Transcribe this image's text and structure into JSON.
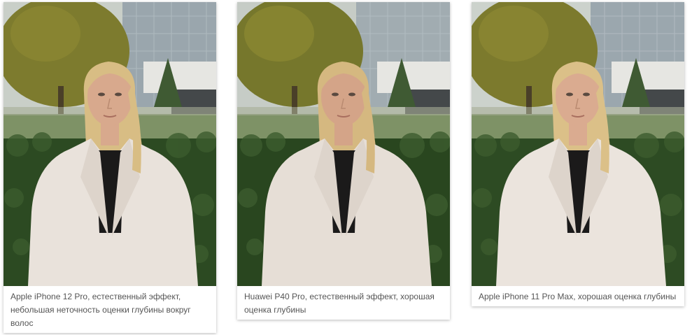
{
  "photos": [
    {
      "caption": "Apple iPhone 12 Pro, естественный эффект, небольшая неточность оценки глубины вокруг волос",
      "subject": "portrait of a blonde woman in a white fluffy coat in front of a hedge",
      "palette": {
        "sky": "#c9cfc8",
        "building": "#9aa6ad",
        "tree": "#7d7b2e",
        "hedge": "#2c4a22",
        "coat": "#e9e2db",
        "hair": "#d8bd84",
        "skin": "#d8a98d",
        "top": "#1b1a1a"
      }
    },
    {
      "caption": "Huawei P40 Pro, естественный эффект, хорошая оценка глубины",
      "subject": "portrait of a blonde woman in a white fluffy coat in front of a hedge",
      "palette": {
        "sky": "#c6ccc6",
        "building": "#a1acb1",
        "tree": "#76772c",
        "hedge": "#29461f",
        "coat": "#e6ded6",
        "hair": "#d5b880",
        "skin": "#d4a488",
        "top": "#1b1a1a"
      }
    },
    {
      "caption": "Apple iPhone 11 Pro Max, хорошая оценка глубины",
      "subject": "portrait of a blonde woman in a white fluffy coat in front of a hedge",
      "palette": {
        "sky": "#ccd2cc",
        "building": "#9ba7ae",
        "tree": "#7c7a2d",
        "hedge": "#2d4b23",
        "coat": "#ebe4dd",
        "hair": "#dbc088",
        "skin": "#daab90",
        "top": "#1b1a1a"
      }
    }
  ]
}
